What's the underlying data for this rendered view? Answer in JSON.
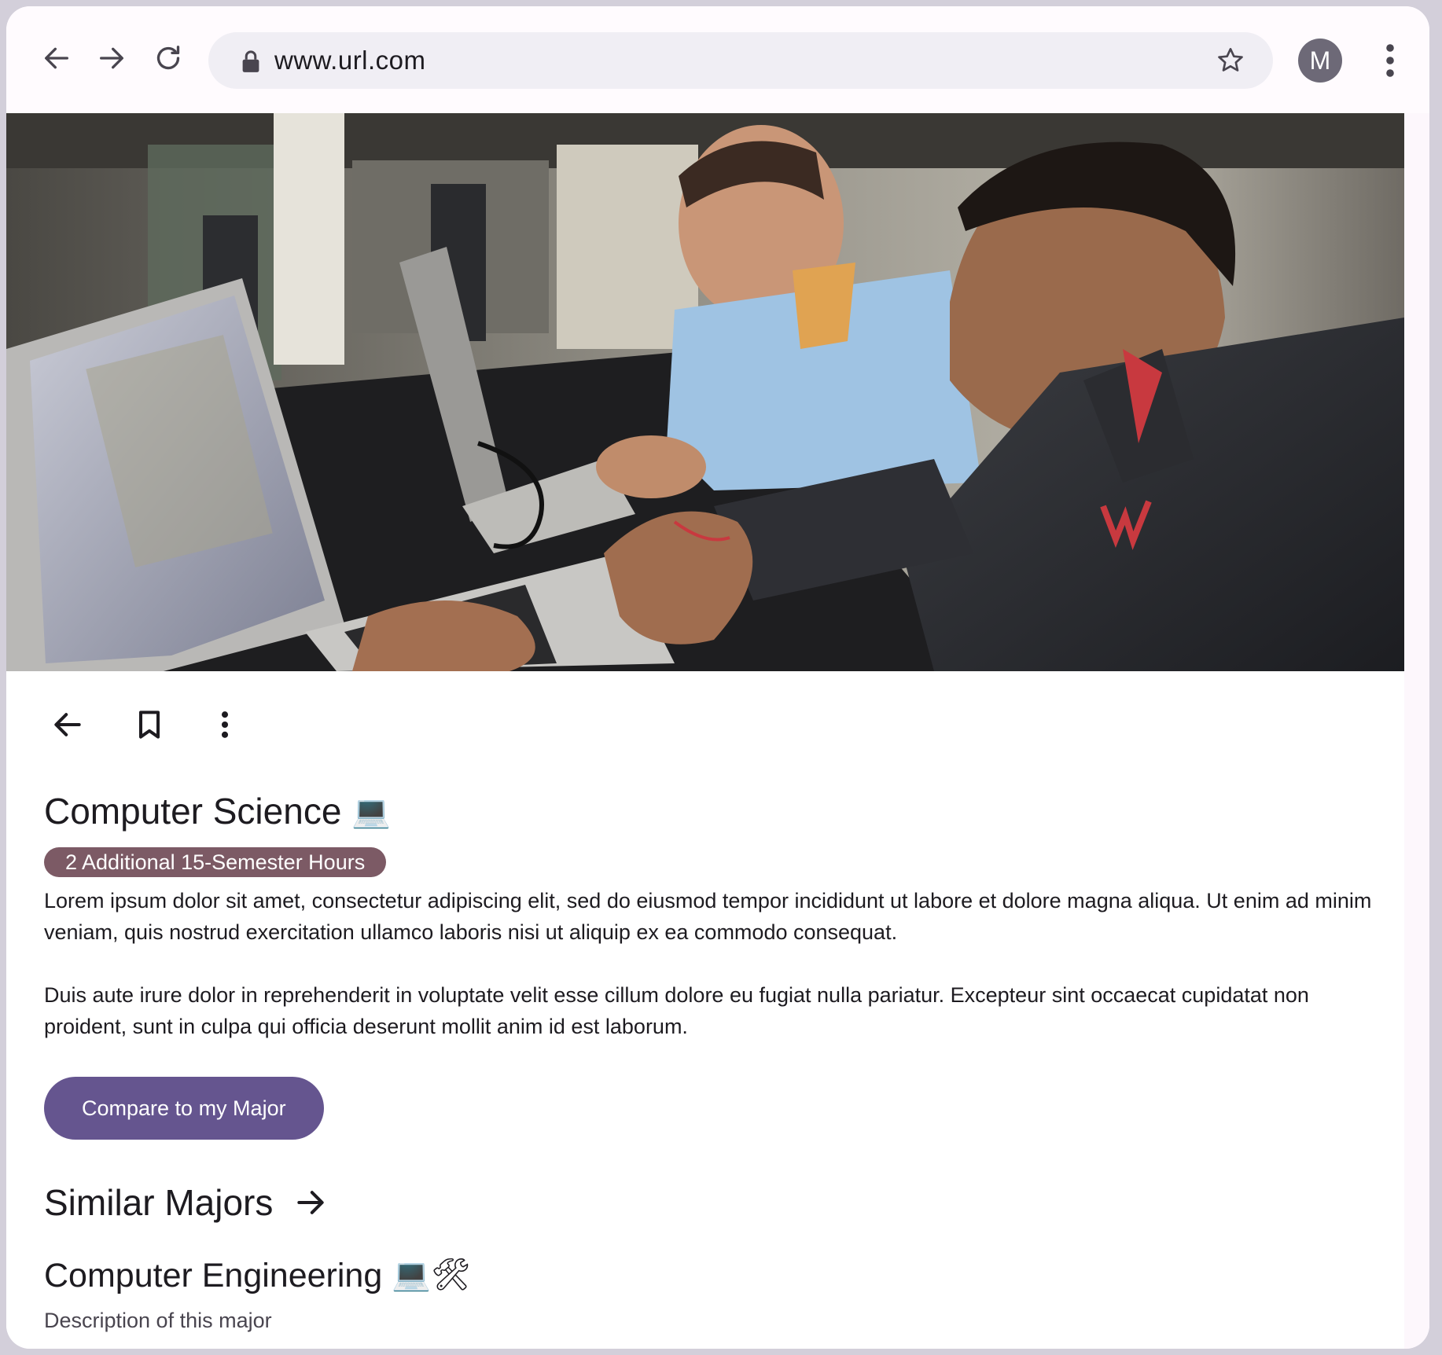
{
  "browser": {
    "url": "www.url.com",
    "avatar_initial": "M"
  },
  "hero": {
    "image": "photo of students working on laptops in a computer lab"
  },
  "major": {
    "title": "Computer Science",
    "title_emoji": "💻",
    "badge": "2 Additional 15-Semester Hours",
    "paragraph_1": "Lorem ipsum dolor sit amet, consectetur adipiscing elit, sed do eiusmod tempor incididunt ut labore et dolore magna aliqua. Ut enim ad minim veniam, quis nostrud exercitation ullamco laboris nisi ut aliquip ex ea commodo consequat.",
    "paragraph_2": "Duis aute irure dolor in reprehenderit in voluptate velit esse cillum dolore eu fugiat nulla pariatur. Excepteur sint occaecat cupidatat non proident, sunt in culpa qui officia deserunt mollit anim id est laborum.",
    "cta_label": "Compare to my Major"
  },
  "similar": {
    "heading": "Similar Majors",
    "items": [
      {
        "title": "Computer Engineering",
        "emoji": "💻🛠",
        "description": "Description of this major"
      }
    ]
  },
  "colors": {
    "badge": "#7c5a65",
    "button": "#65558f",
    "chrome_bg": "#fffbfe",
    "omnibox": "#f0eef4"
  }
}
